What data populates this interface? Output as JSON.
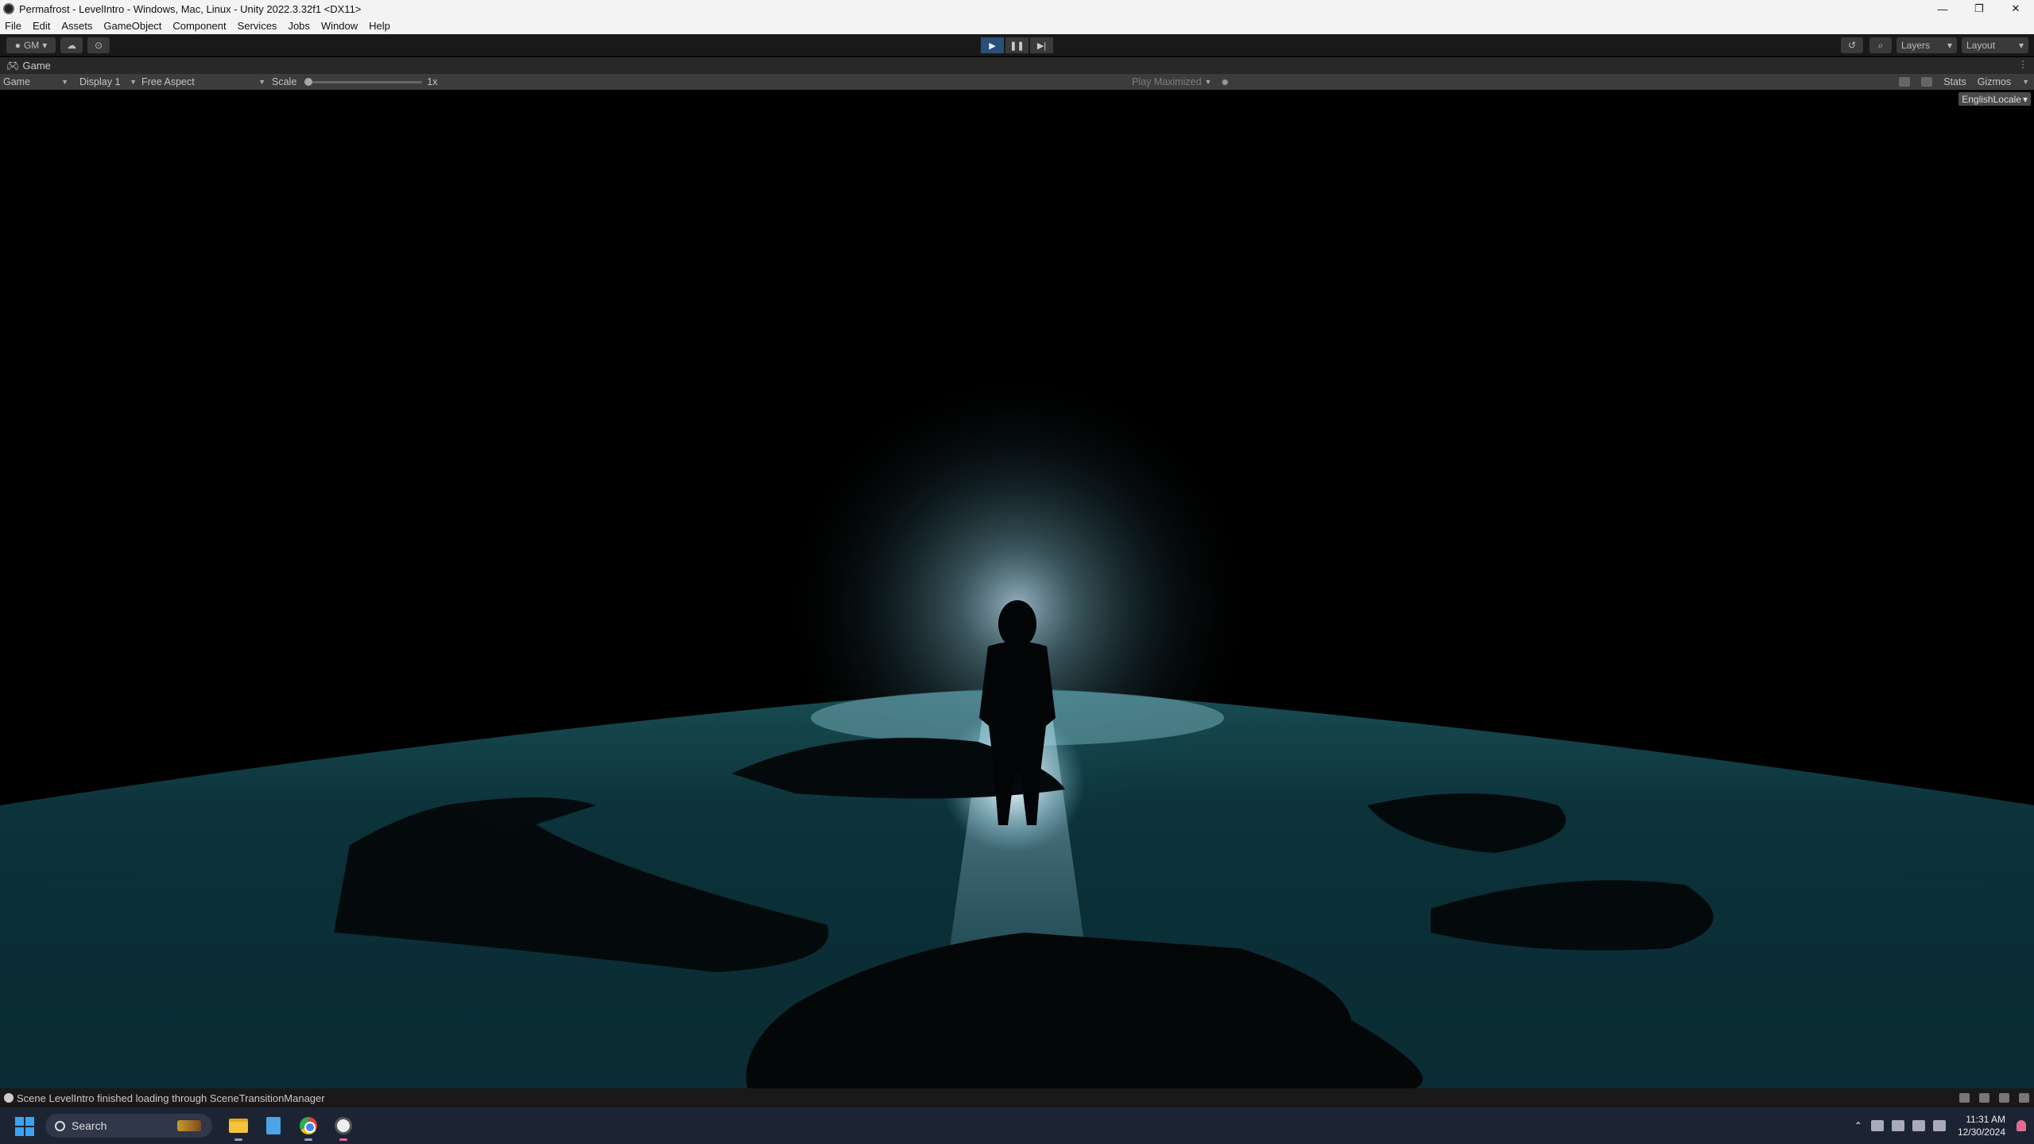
{
  "window": {
    "title": "Permafrost - LevelIntro - Windows, Mac, Linux - Unity 2022.3.32f1 <DX11>",
    "controls": [
      "—",
      "❐",
      "✕"
    ]
  },
  "menu": [
    "File",
    "Edit",
    "Assets",
    "GameObject",
    "Component",
    "Services",
    "Jobs",
    "Window",
    "Help"
  ],
  "toolbar": {
    "account_label": "GM",
    "layers_label": "Layers",
    "layout_label": "Layout",
    "play_state": "playing"
  },
  "tab": {
    "label": "Game"
  },
  "game_toolbar": {
    "mode": "Game",
    "display": "Display 1",
    "aspect": "Free Aspect",
    "scale_label": "Scale",
    "scale_value": "1x",
    "scale_fraction": 0.0,
    "play_mode": "Play Maximized",
    "stats_label": "Stats",
    "gizmos_label": "Gizmos",
    "locale": "EnglishLocale"
  },
  "status": {
    "message": "Scene LevelIntro finished loading through SceneTransitionManager"
  },
  "taskbar": {
    "search_placeholder": "Search",
    "time": "11:31 AM",
    "date": "12/30/2024"
  },
  "colors": {
    "play_active": "#2a4f77",
    "water": "#0e3a3e",
    "glow": "#c8ecff"
  }
}
